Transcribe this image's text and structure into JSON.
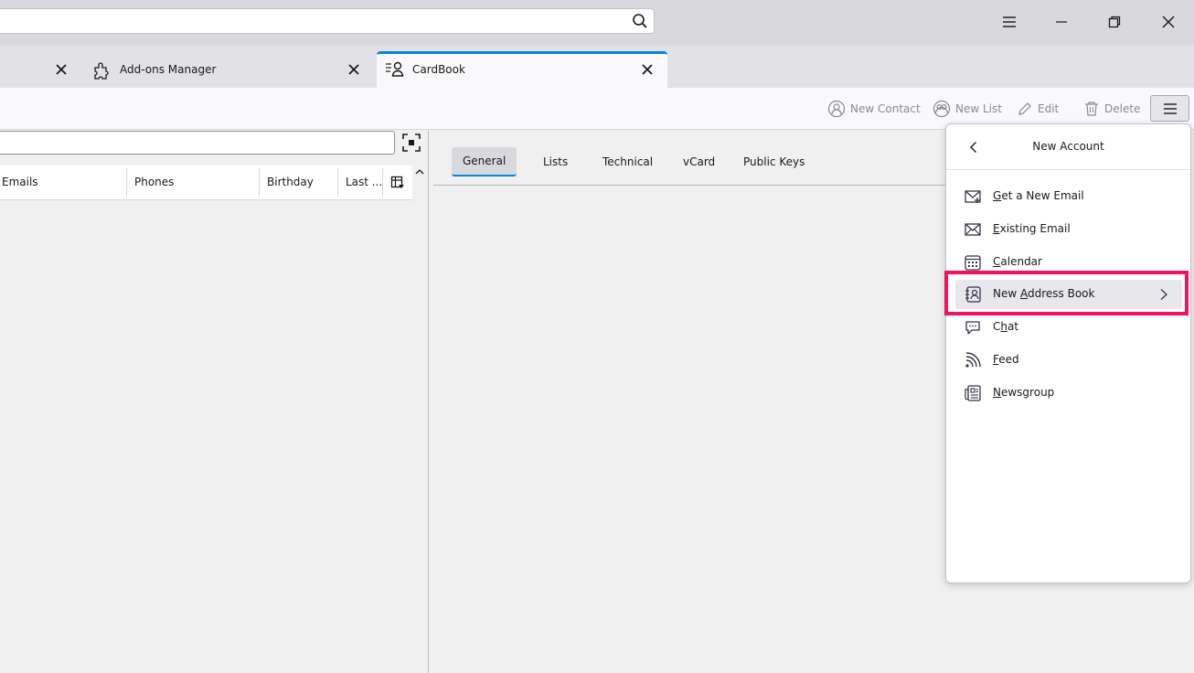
{
  "titlebar": {
    "window_buttons": [
      "menu-icon",
      "minimize-icon",
      "restore-icon",
      "close-icon"
    ]
  },
  "tabs": [
    {
      "label": "",
      "icon": "close-icon"
    },
    {
      "label": "Add-ons Manager",
      "icon": "puzzle-icon"
    },
    {
      "label": "CardBook",
      "icon": "cardbook-icon",
      "active": true
    }
  ],
  "toolbar": {
    "new_contact": "New Contact",
    "new_list": "New List",
    "edit": "Edit",
    "delete": "Delete"
  },
  "contacts_table": {
    "columns": [
      "Emails",
      "Phones",
      "Birthday",
      "Last ..."
    ]
  },
  "detail_tabs": [
    "General",
    "Lists",
    "Technical",
    "vCard",
    "Public Keys"
  ],
  "popup": {
    "title": "New Account",
    "items": [
      {
        "pre": "",
        "key": "G",
        "post": "et a New Email",
        "icon": "new-email-icon"
      },
      {
        "pre": "",
        "key": "E",
        "post": "xisting Email",
        "icon": "email-icon"
      },
      {
        "pre": "",
        "key": "C",
        "post": "alendar",
        "icon": "calendar-icon"
      },
      {
        "pre": "New ",
        "key": "A",
        "post": "ddress Book",
        "icon": "address-book-icon"
      },
      {
        "pre": "C",
        "key": "h",
        "post": "at",
        "icon": "chat-icon"
      },
      {
        "pre": "",
        "key": "F",
        "post": "eed",
        "icon": "feed-icon"
      },
      {
        "pre": "",
        "key": "N",
        "post": "ewsgroup",
        "icon": "newsgroup-icon"
      }
    ]
  },
  "colors": {
    "accent": "#0a84d9",
    "highlight": "#f0135f"
  }
}
